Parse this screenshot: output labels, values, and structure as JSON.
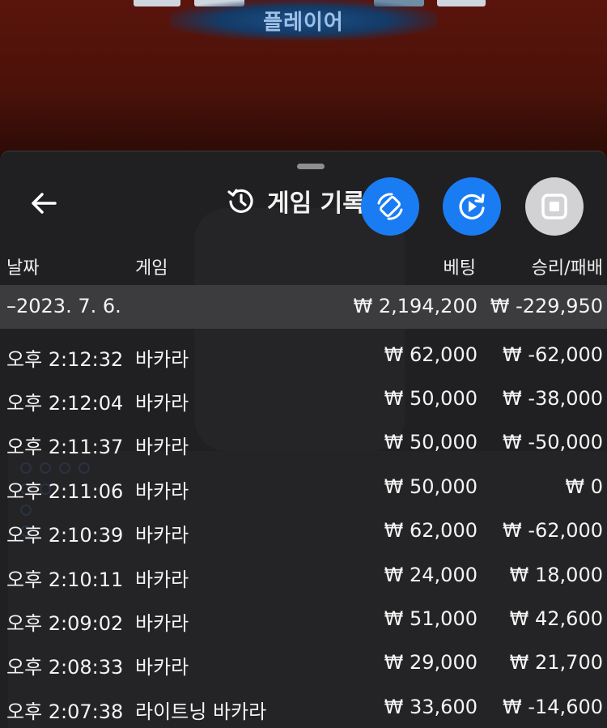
{
  "background": {
    "banner_label": "플레이어"
  },
  "panel": {
    "title": "게임 기록",
    "columns": {
      "date": "날짜",
      "game": "게임",
      "bet": "베팅",
      "result": "승리/패배"
    },
    "summary": {
      "date": "–2023. 7. 6.",
      "bet": "₩ 2,194,200",
      "result": "₩ -229,950"
    },
    "rows": [
      {
        "time": "오후 2:12:32",
        "game": "바카라",
        "bet": "₩ 62,000",
        "result": "₩ -62,000"
      },
      {
        "time": "오후 2:12:04",
        "game": "바카라",
        "bet": "₩ 50,000",
        "result": "₩ -38,000"
      },
      {
        "time": "오후 2:11:37",
        "game": "바카라",
        "bet": "₩ 50,000",
        "result": "₩ -50,000"
      },
      {
        "time": "오후 2:11:06",
        "game": "바카라",
        "bet": "₩ 50,000",
        "result": "₩ 0"
      },
      {
        "time": "오후 2:10:39",
        "game": "바카라",
        "bet": "₩ 62,000",
        "result": "₩ -62,000"
      },
      {
        "time": "오후 2:10:11",
        "game": "바카라",
        "bet": "₩ 24,000",
        "result": "₩ 18,000"
      },
      {
        "time": "오후 2:09:02",
        "game": "바카라",
        "bet": "₩ 51,000",
        "result": "₩ 42,600"
      },
      {
        "time": "오후 2:08:33",
        "game": "바카라",
        "bet": "₩ 29,000",
        "result": "₩ 21,700"
      },
      {
        "time": "오후 2:07:38",
        "game": "라이트닝 바카라",
        "bet": "₩ 33,600",
        "result": "₩ -14,600"
      }
    ]
  },
  "icons": {
    "back": "arrow-left-icon",
    "history": "history-icon",
    "fab1": "rotate-device-icon",
    "fab2": "replay-icon",
    "fab3": "stop-icon"
  },
  "colors": {
    "panel_bg": "#202022",
    "summary_bg": "#3c3c3e",
    "fab_blue": "#1a7cf2",
    "fab_gray": "#d2d2d4"
  }
}
